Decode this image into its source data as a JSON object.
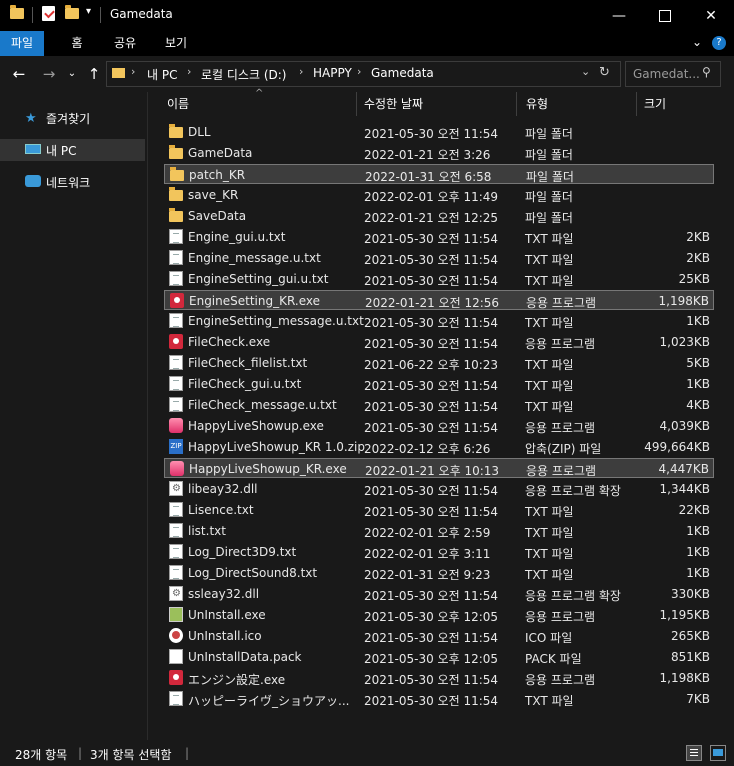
{
  "window": {
    "title": "Gamedata",
    "minimize_icon": "minimize-icon",
    "maximize_icon": "maximize-icon",
    "close_icon": "close-icon"
  },
  "ribbon": {
    "tabs": [
      "파일",
      "홈",
      "공유",
      "보기"
    ],
    "file_tab_color": "#1979ca"
  },
  "nav": {
    "breadcrumb": [
      "내 PC",
      "로컬 디스크 (D:)",
      "HAPPY",
      "Gamedata"
    ],
    "search_placeholder": "Gamedat..."
  },
  "navpane": {
    "items": [
      {
        "label": "즐겨찾기",
        "icon": "star-icon"
      },
      {
        "label": "내 PC",
        "icon": "computer-icon"
      },
      {
        "label": "네트워크",
        "icon": "network-icon"
      }
    ]
  },
  "columns": {
    "name": "이름",
    "date": "수정한 날짜",
    "type": "유형",
    "size": "크기"
  },
  "files": [
    {
      "name": "DLL",
      "date": "2021-05-30 오전 11:54",
      "type": "파일 폴더",
      "size": "",
      "icon": "folder"
    },
    {
      "name": "GameData",
      "date": "2022-01-21 오전 3:26",
      "type": "파일 폴더",
      "size": "",
      "icon": "folder"
    },
    {
      "name": "patch_KR",
      "date": "2022-01-31 오전 6:58",
      "type": "파일 폴더",
      "size": "",
      "icon": "folder",
      "selected": true
    },
    {
      "name": "save_KR",
      "date": "2022-02-01 오후 11:49",
      "type": "파일 폴더",
      "size": "",
      "icon": "folder"
    },
    {
      "name": "SaveData",
      "date": "2022-01-21 오전 12:25",
      "type": "파일 폴더",
      "size": "",
      "icon": "folder"
    },
    {
      "name": "Engine_gui.u.txt",
      "date": "2021-05-30 오전 11:54",
      "type": "TXT 파일",
      "size": "2KB",
      "icon": "txt"
    },
    {
      "name": "Engine_message.u.txt",
      "date": "2021-05-30 오전 11:54",
      "type": "TXT 파일",
      "size": "2KB",
      "icon": "txt"
    },
    {
      "name": "EngineSetting_gui.u.txt",
      "date": "2021-05-30 오전 11:54",
      "type": "TXT 파일",
      "size": "25KB",
      "icon": "txt"
    },
    {
      "name": "EngineSetting_KR.exe",
      "date": "2022-01-21 오전 12:56",
      "type": "응용 프로그램",
      "size": "1,198KB",
      "icon": "exe",
      "selected": true
    },
    {
      "name": "EngineSetting_message.u.txt",
      "date": "2021-05-30 오전 11:54",
      "type": "TXT 파일",
      "size": "1KB",
      "icon": "txt"
    },
    {
      "name": "FileCheck.exe",
      "date": "2021-05-30 오전 11:54",
      "type": "응용 프로그램",
      "size": "1,023KB",
      "icon": "exe"
    },
    {
      "name": "FileCheck_filelist.txt",
      "date": "2021-06-22 오후 10:23",
      "type": "TXT 파일",
      "size": "5KB",
      "icon": "txt"
    },
    {
      "name": "FileCheck_gui.u.txt",
      "date": "2021-05-30 오전 11:54",
      "type": "TXT 파일",
      "size": "1KB",
      "icon": "txt"
    },
    {
      "name": "FileCheck_message.u.txt",
      "date": "2021-05-30 오전 11:54",
      "type": "TXT 파일",
      "size": "4KB",
      "icon": "txt"
    },
    {
      "name": "HappyLiveShowup.exe",
      "date": "2021-05-30 오전 11:54",
      "type": "응용 프로그램",
      "size": "4,039KB",
      "icon": "happy"
    },
    {
      "name": "HappyLiveShowup_KR 1.0.zip",
      "date": "2022-02-12 오후 6:26",
      "type": "압축(ZIP) 파일",
      "size": "499,664KB",
      "icon": "zip"
    },
    {
      "name": "HappyLiveShowup_KR.exe",
      "date": "2022-01-21 오후 10:13",
      "type": "응용 프로그램",
      "size": "4,447KB",
      "icon": "happy",
      "selected": true
    },
    {
      "name": "libeay32.dll",
      "date": "2021-05-30 오전 11:54",
      "type": "응용 프로그램 확장",
      "size": "1,344KB",
      "icon": "dll"
    },
    {
      "name": "Lisence.txt",
      "date": "2021-05-30 오전 11:54",
      "type": "TXT 파일",
      "size": "22KB",
      "icon": "txt"
    },
    {
      "name": "list.txt",
      "date": "2022-02-01 오후 2:59",
      "type": "TXT 파일",
      "size": "1KB",
      "icon": "txt"
    },
    {
      "name": "Log_Direct3D9.txt",
      "date": "2022-02-01 오후 3:11",
      "type": "TXT 파일",
      "size": "1KB",
      "icon": "txt"
    },
    {
      "name": "Log_DirectSound8.txt",
      "date": "2022-01-31 오전 9:23",
      "type": "TXT 파일",
      "size": "1KB",
      "icon": "txt"
    },
    {
      "name": "ssleay32.dll",
      "date": "2021-05-30 오전 11:54",
      "type": "응용 프로그램 확장",
      "size": "330KB",
      "icon": "dll"
    },
    {
      "name": "UnInstall.exe",
      "date": "2021-05-30 오후 12:05",
      "type": "응용 프로그램",
      "size": "1,195KB",
      "icon": "uninst"
    },
    {
      "name": "UnInstall.ico",
      "date": "2021-05-30 오전 11:54",
      "type": "ICO 파일",
      "size": "265KB",
      "icon": "ico"
    },
    {
      "name": "UnInstallData.pack",
      "date": "2021-05-30 오후 12:05",
      "type": "PACK 파일",
      "size": "851KB",
      "icon": "pack"
    },
    {
      "name": "エンジン設定.exe",
      "date": "2021-05-30 오전 11:54",
      "type": "응용 프로그램",
      "size": "1,198KB",
      "icon": "exe"
    },
    {
      "name": "ハッピーライヴ_ショウアッ...",
      "date": "2021-05-30 오전 11:54",
      "type": "TXT 파일",
      "size": "7KB",
      "icon": "txt"
    }
  ],
  "status": {
    "item_count": "28개 항목",
    "selected_count": "3개 항목 선택함"
  }
}
